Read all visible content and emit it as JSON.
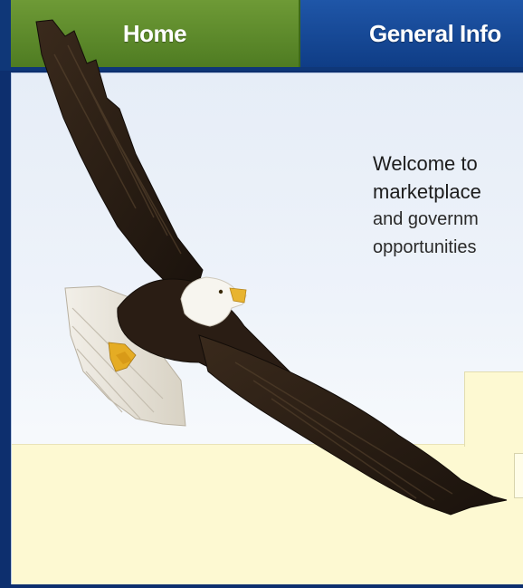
{
  "nav": {
    "tabs": [
      {
        "label": "Home"
      },
      {
        "label": "General Info"
      }
    ]
  },
  "welcome": {
    "lines": [
      "Welcome to",
      "marketplace",
      "and governm",
      "opportunities"
    ]
  },
  "image": {
    "icon": "bald-eagle-illustration"
  },
  "colors": {
    "nav_background": "#0f3778",
    "home_tab": "#5d8a2c",
    "general_tab": "#174a98",
    "content_background": "#eef3fa",
    "cream_panel": "#fdf9d2"
  }
}
